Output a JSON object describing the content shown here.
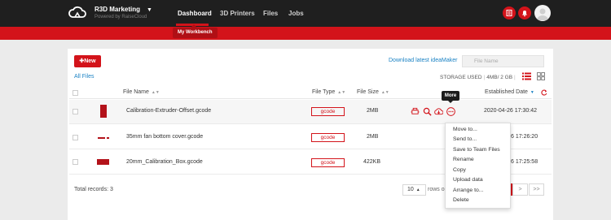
{
  "header": {
    "brand_name": "R3D Marketing",
    "brand_caret": "▼",
    "brand_subtitle": "Powered by RaiseCloud",
    "nav": [
      "Dashboard",
      "3D Printers",
      "Files",
      "Jobs"
    ],
    "active_nav": "Dashboard",
    "workbench_label": "My Workbench"
  },
  "toolbar": {
    "new_label": "✚New",
    "download_link": "Download latest ideaMaker",
    "search_placeholder": "File Name",
    "all_files": "All Files",
    "storage_label": "STORAGE USED",
    "storage_value": "4MB/ 2 GB"
  },
  "table": {
    "columns": [
      "File Name",
      "File Type",
      "File Size",
      "Established Date"
    ],
    "rows": [
      {
        "name": "Calibration-Extruder-Offset.gcode",
        "type": "gcode",
        "size": "2MB",
        "date": "2020-04-26 17:30:42"
      },
      {
        "name": "35mm fan bottom cover.gcode",
        "type": "gcode",
        "size": "2MB",
        "date": "6 17:26:20"
      },
      {
        "name": "20mm_Calibration_Box.gcode",
        "type": "gcode",
        "size": "422KB",
        "date": "6 17:25:58"
      }
    ]
  },
  "tooltip": "More",
  "more_menu": [
    "Move to...",
    "Send to...",
    "Save to Team Files",
    "Rename",
    "Copy",
    "Upload  data",
    "Arrange to...",
    "Delete"
  ],
  "footer": {
    "total_records": "Total records: 3",
    "page_size": "10",
    "page_size_caret": "▲",
    "page_size_tail": "rows on",
    "next": ">",
    "last": ">>"
  },
  "colors": {
    "accent": "#d3131a",
    "link": "#1a82c4",
    "topbar": "#1f1f1f"
  }
}
